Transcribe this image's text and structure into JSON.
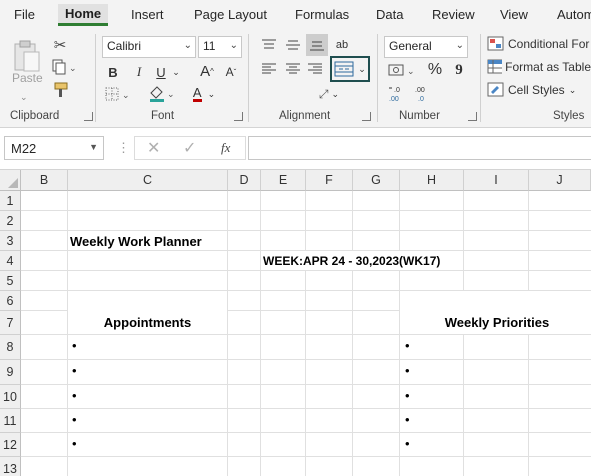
{
  "menu": {
    "tabs": [
      "File",
      "Home",
      "Insert",
      "Page Layout",
      "Formulas",
      "Data",
      "Review",
      "View",
      "Autom"
    ],
    "active_tab": "Home"
  },
  "ribbon": {
    "clipboard": {
      "label": "Clipboard",
      "paste_label": "Paste"
    },
    "font": {
      "label": "Font",
      "font_name": "Calibri",
      "font_size": "11",
      "bold": "B",
      "italic": "I",
      "underline": "U",
      "grow": "A",
      "shrink": "A",
      "color_letter": "A"
    },
    "alignment": {
      "label": "Alignment",
      "wrap": "ab"
    },
    "number": {
      "label": "Number",
      "format": "General",
      "percent": "%",
      "comma": "9",
      "inc_decimal": ".0 .00",
      "dec_decimal": ".00 .0"
    },
    "styles": {
      "label": "Styles",
      "conditional": "Conditional For",
      "format_table": "Format as Table",
      "cell_styles": "Cell Styles"
    }
  },
  "formula_bar": {
    "name_box": "M22",
    "fx": "fx",
    "formula": ""
  },
  "sheet": {
    "columns": [
      "B",
      "C",
      "D",
      "E",
      "F",
      "G",
      "H",
      "I",
      "J"
    ],
    "rows": [
      "1",
      "2",
      "3",
      "4",
      "5",
      "6",
      "7",
      "8",
      "9",
      "10",
      "11",
      "12",
      "13"
    ],
    "title": "Weekly Work Planner",
    "week": "WEEK:APR 24 - 30,2023(WK17)",
    "appointments_header": "Appointments",
    "priorities_header": "Weekly Priorities",
    "bullet": "•"
  },
  "colors": {
    "accent": "#2e7d32",
    "header_bg": "#efefef",
    "gridline": "#e0e0e0",
    "selected_outline": "#1f4e4f"
  }
}
